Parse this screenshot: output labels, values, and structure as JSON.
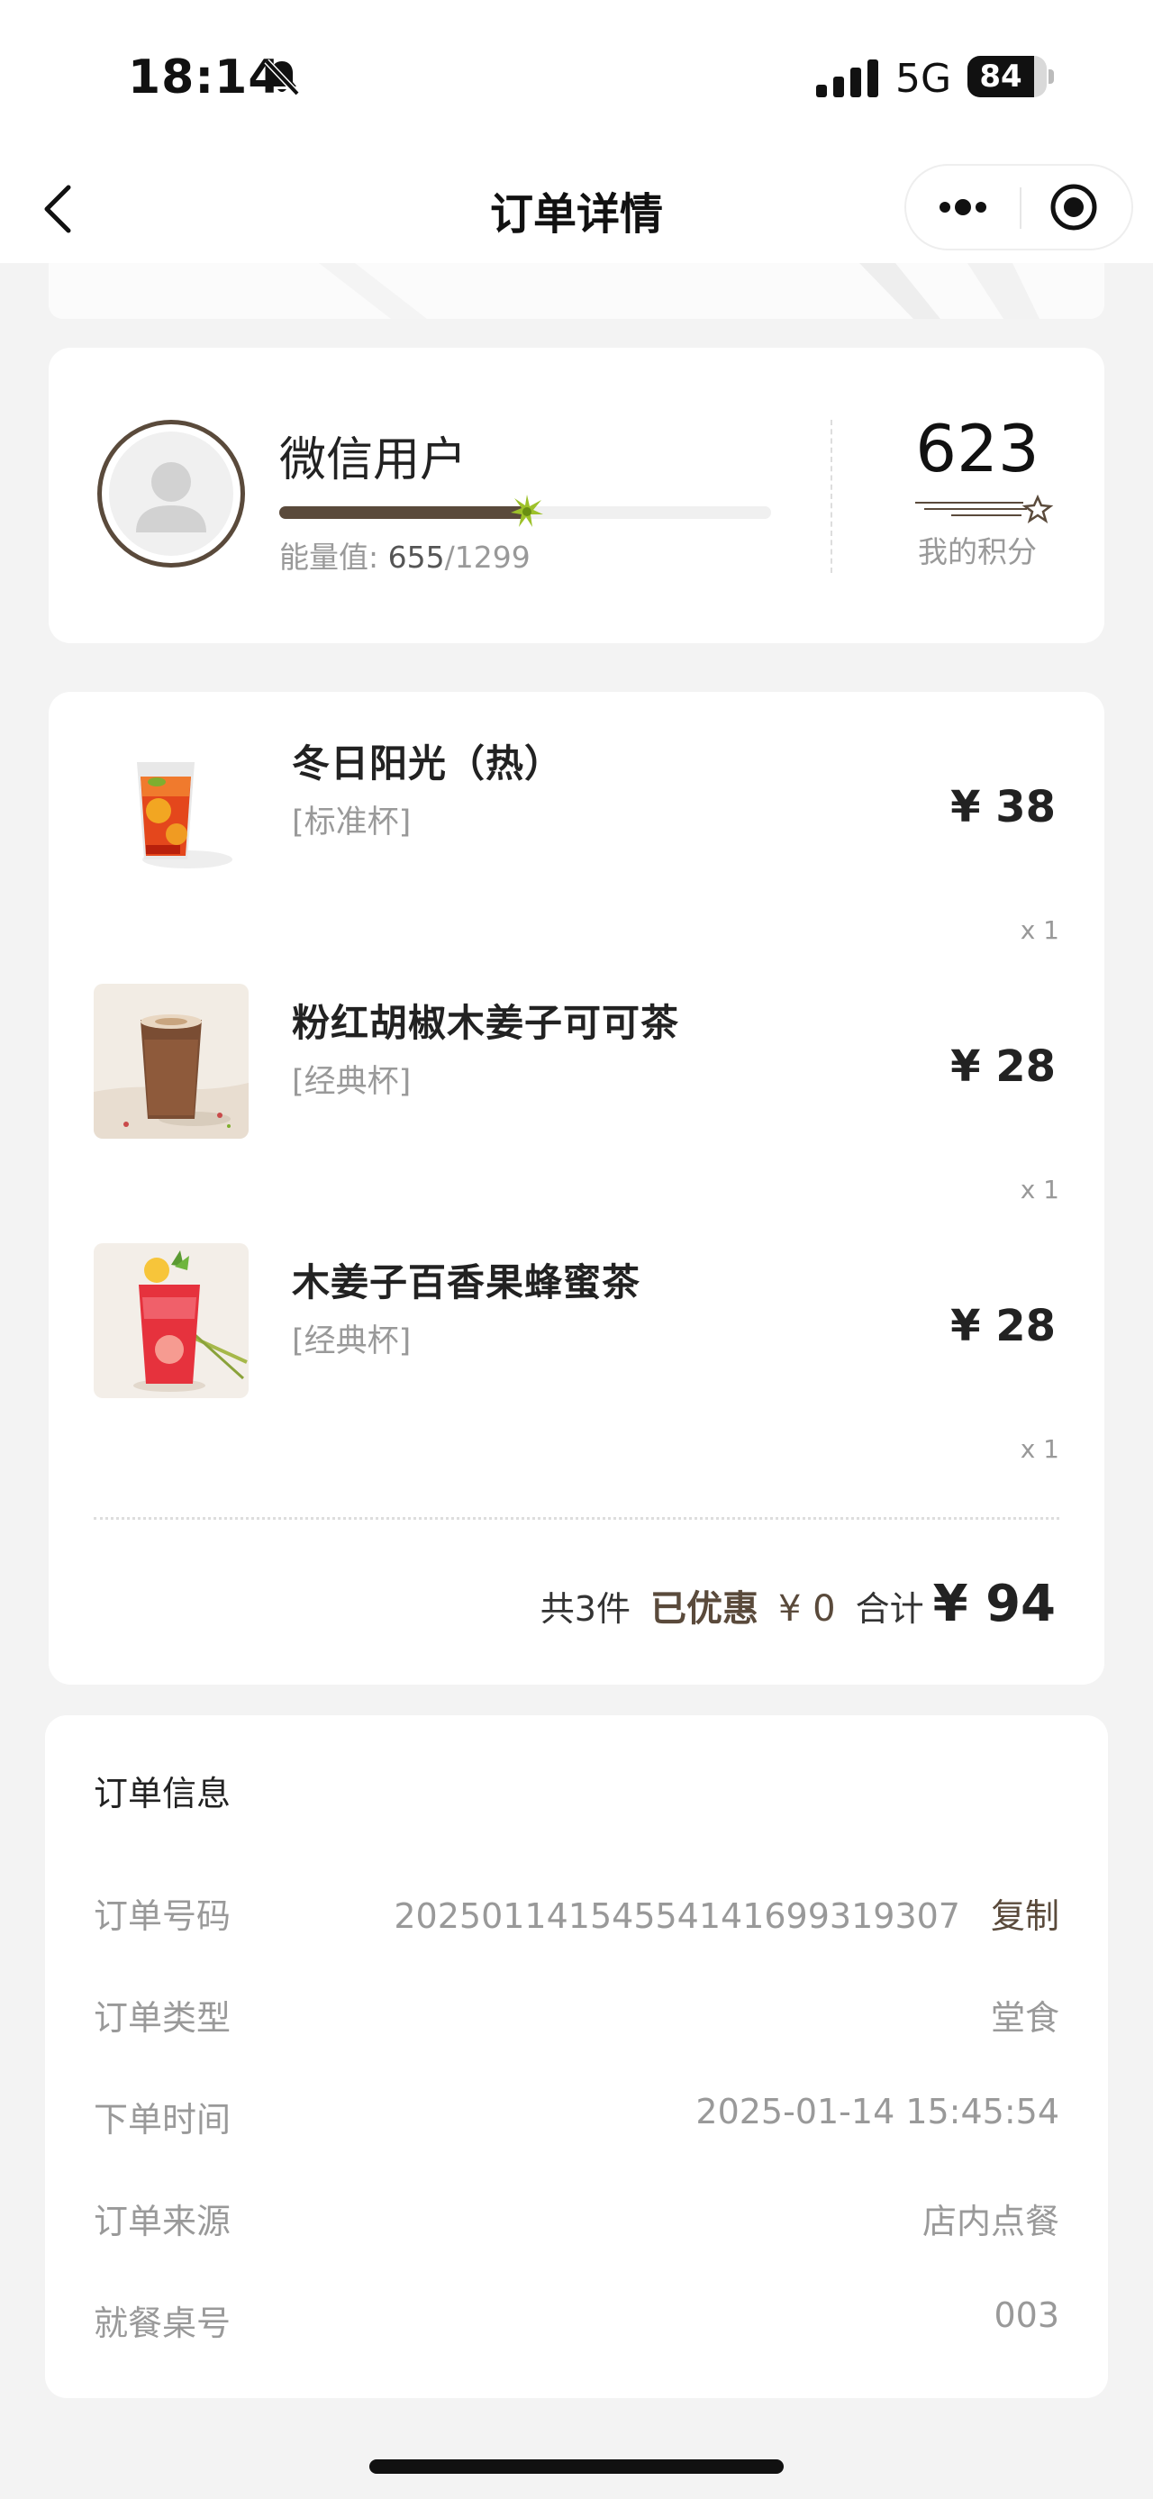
{
  "status_bar": {
    "time": "18:14",
    "network": "5G",
    "battery": "84",
    "battery_level": 0.84
  },
  "nav": {
    "title": "订单详情"
  },
  "member": {
    "name": "微信用户",
    "energy_label": "能量值:",
    "energy_current": "655",
    "energy_total": "/1299",
    "energy_progress": 0.504,
    "points": "623",
    "points_label": "我的积分"
  },
  "order_items": [
    {
      "name": "冬日阳光（热）",
      "spec": "[标准杯]",
      "price": "¥ 38",
      "qty": "x 1",
      "image": "iced-tea-drink-icon"
    },
    {
      "name": "粉红胡椒木姜子可可茶",
      "spec": "[经典杯]",
      "price": "¥ 28",
      "qty": "x 1",
      "image": "cocoa-drink-icon"
    },
    {
      "name": "木姜子百香果蜂蜜茶",
      "spec": "[经典杯]",
      "price": "¥ 28",
      "qty": "x 1",
      "image": "fruit-tea-drink-icon"
    }
  ],
  "summary": {
    "count": "共3件",
    "discount_label": "已优惠",
    "discount": "¥ 0",
    "total_label": "合计",
    "total": "¥ 94"
  },
  "order_info": {
    "title": "订单信息",
    "rows": [
      {
        "label": "订单号码",
        "value": "202501141545541416993193​07"
      },
      {
        "label": "订单类型",
        "value": "堂食"
      },
      {
        "label": "下单时间",
        "value": "2025-01-14 15:45:54"
      },
      {
        "label": "订单来源",
        "value": "店内点餐"
      },
      {
        "label": "就餐桌号",
        "value": "003"
      }
    ],
    "copy_label": "复制"
  },
  "colors": {
    "accent": "#5a4a3b",
    "muted_text": "#999999",
    "background": "#f3f3f3"
  }
}
